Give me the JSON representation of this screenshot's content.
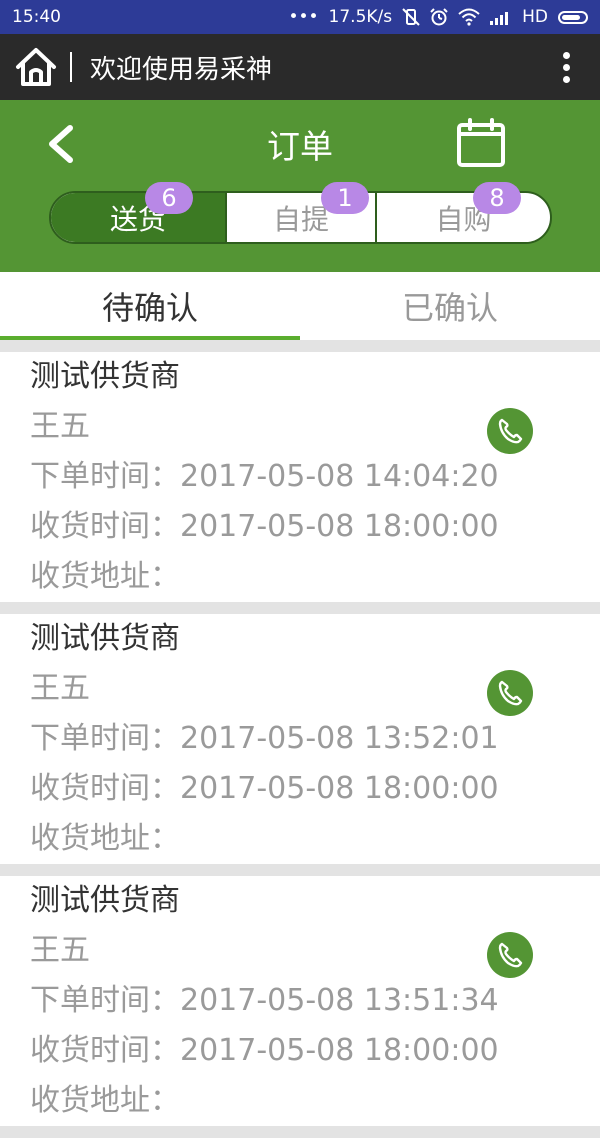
{
  "status_bar": {
    "time": "15:40",
    "dots": "•••",
    "speed": "17.5K/s",
    "network": "HD"
  },
  "app_bar": {
    "title": "欢迎使用易采神"
  },
  "header": {
    "title": "订单"
  },
  "segments": [
    {
      "label": "送货",
      "count": "6"
    },
    {
      "label": "自提",
      "count": "1"
    },
    {
      "label": "自购",
      "count": "8"
    }
  ],
  "tabs": [
    {
      "label": "待确认"
    },
    {
      "label": "已确认"
    }
  ],
  "orders": [
    {
      "supplier": "测试供货商",
      "contact": "王五",
      "order_time": "下单时间：2017-05-08 14:04:20",
      "delivery_time": "收货时间：2017-05-08 18:00:00",
      "address": "收货地址："
    },
    {
      "supplier": "测试供货商",
      "contact": "王五",
      "order_time": "下单时间：2017-05-08 13:52:01",
      "delivery_time": "收货时间：2017-05-08 18:00:00",
      "address": "收货地址："
    },
    {
      "supplier": "测试供货商",
      "contact": "王五",
      "order_time": "下单时间：2017-05-08 13:51:34",
      "delivery_time": "收货时间：2017-05-08 18:00:00",
      "address": "收货地址："
    }
  ],
  "icons": {
    "home": "home-icon",
    "more": "more-vertical-icon",
    "back": "chevron-left-icon",
    "calendar": "calendar-icon",
    "phone": "phone-icon"
  },
  "colors": {
    "status_bar": "#2d3b97",
    "app_bar": "#2a2a2a",
    "header_green": "#549534",
    "active_segment": "#3c7a23",
    "badge": "#b888e6",
    "tab_indicator": "#5aad2e"
  }
}
